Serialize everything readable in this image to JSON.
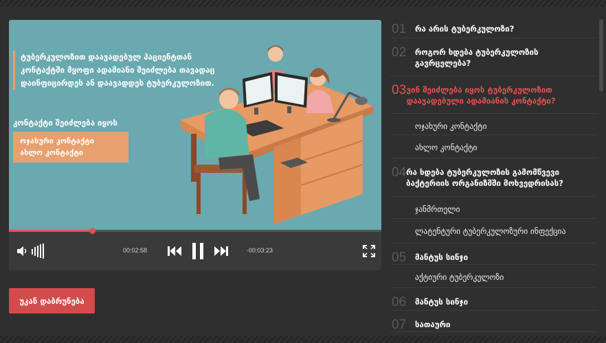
{
  "slide": {
    "intro_text": "ტუბერკულოზით დაავადებულ პაციენტთან კონტაქტში მყოფი ადამიანი შეიძლება თავადაც დაინფიცირდეს ან დაავადდეს ტუბერკულოზით.",
    "contact_title": "კონტაქტი შეიძლება იყოს",
    "contact_options": [
      "ოჯახური კონტაქტი",
      "ახლო კონტაქტი"
    ]
  },
  "player": {
    "progress": 0.224,
    "elapsed": "00:02:58",
    "remaining": "-00:03:23"
  },
  "back_button": "უკან დაბრუნება",
  "menu": [
    {
      "num": "01",
      "label": "რა არის ტუბერკულოზი?",
      "type": "main",
      "active": false
    },
    {
      "num": "02",
      "label": "როგორ ხდება ტუბერკულოზის გავრცელება?",
      "type": "main",
      "active": false
    },
    {
      "num": "03",
      "label": "ვინ შეიძლება იყოს ტუბერკულოზით დაავადებული ადამიანის  კონტაქტი?",
      "type": "main",
      "active": true
    },
    {
      "num": "",
      "label": "ოჯახური კონტაქტი",
      "type": "sub",
      "active": false
    },
    {
      "num": "",
      "label": "ახლო კონტაქტი",
      "type": "sub",
      "active": false
    },
    {
      "num": "04",
      "label": "რა ხდება ტუბერკულოზის გამომწვევი ბაქტერიის ორგანიზმში მოხვედრისას?",
      "type": "main",
      "active": false
    },
    {
      "num": "",
      "label": "ჯანმრთელი",
      "type": "sub",
      "active": false
    },
    {
      "num": "",
      "label": "ლატენტური ტუბერკულოზური ინფექცია",
      "type": "sub",
      "active": false
    },
    {
      "num": "05",
      "label": "მანტუს სინჯი",
      "type": "main",
      "active": false
    },
    {
      "num": "",
      "label": "აქტიური ტუბერკულოზი",
      "type": "sub",
      "active": false
    },
    {
      "num": "06",
      "label": "მანტუს სინჯი",
      "type": "main",
      "active": false
    },
    {
      "num": "07",
      "label": "სათაური",
      "type": "main",
      "active": false
    }
  ]
}
